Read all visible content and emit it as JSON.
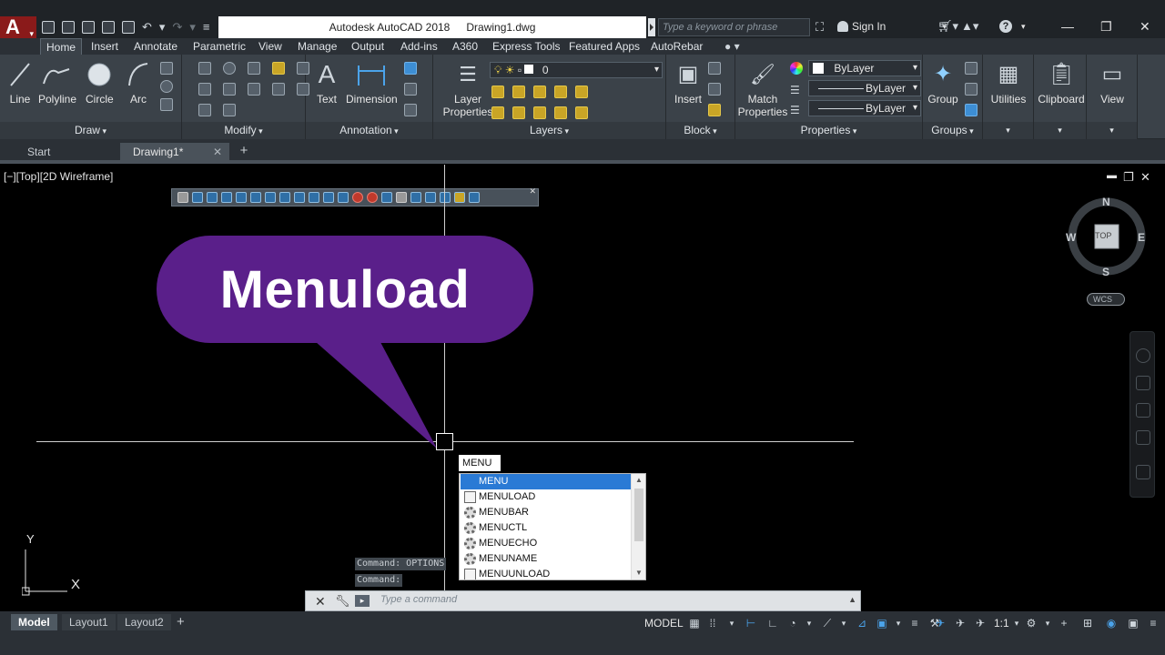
{
  "app": {
    "logo": "A",
    "title_app": "Autodesk AutoCAD 2018",
    "title_doc": "Drawing1.dwg",
    "search_placeholder": "Type a keyword or phrase",
    "sign_in": "Sign In"
  },
  "ribbon_tabs": [
    {
      "label": "Home",
      "active": true
    },
    {
      "label": "Insert"
    },
    {
      "label": "Annotate"
    },
    {
      "label": "Parametric"
    },
    {
      "label": "View"
    },
    {
      "label": "Manage"
    },
    {
      "label": "Output"
    },
    {
      "label": "Add-ins"
    },
    {
      "label": "A360"
    },
    {
      "label": "Express Tools"
    },
    {
      "label": "Featured Apps"
    },
    {
      "label": "AutoRebar"
    }
  ],
  "ribbon": {
    "draw": {
      "title": "Draw",
      "line": "Line",
      "polyline": "Polyline",
      "circle": "Circle",
      "arc": "Arc"
    },
    "modify": {
      "title": "Modify"
    },
    "annotation": {
      "title": "Annotation",
      "text": "Text",
      "dimension": "Dimension"
    },
    "layers": {
      "title": "Layers",
      "layer_properties_1": "Layer",
      "layer_properties_2": "Properties",
      "current_layer": "0"
    },
    "block": {
      "title": "Block",
      "insert": "Insert"
    },
    "properties": {
      "title": "Properties",
      "match_1": "Match",
      "match_2": "Properties",
      "color": "ByLayer",
      "linetype": "ByLayer",
      "lineweight": "ByLayer"
    },
    "groups": {
      "title": "Groups",
      "group": "Group"
    },
    "utilities": "Utilities",
    "clipboard": "Clipboard",
    "view": "View"
  },
  "file_tabs": [
    {
      "label": "Start"
    },
    {
      "label": "Drawing1*",
      "active": true
    }
  ],
  "viewport": {
    "label": "[−][Top][2D Wireframe]",
    "bubble_text": "Menuload",
    "compass": {
      "n": "N",
      "s": "S",
      "e": "E",
      "w": "W",
      "face": "TOP"
    },
    "wcs": "WCS",
    "ucs_x": "X",
    "ucs_y": "Y"
  },
  "autocomplete": {
    "typed": "MENU",
    "items": [
      {
        "label": "MENU",
        "icon": "none",
        "selected": true
      },
      {
        "label": "MENULOAD",
        "icon": "doc-icon"
      },
      {
        "label": "MENUBAR",
        "icon": "gear-icon"
      },
      {
        "label": "MENUCTL",
        "icon": "gear-icon"
      },
      {
        "label": "MENUECHO",
        "icon": "gear-icon"
      },
      {
        "label": "MENUNAME",
        "icon": "gear-icon"
      },
      {
        "label": "MENUUNLOAD",
        "icon": "doc-icon"
      }
    ]
  },
  "command": {
    "history_1": "Command: OPTIONS",
    "history_2": "Command:",
    "placeholder": "Type a command"
  },
  "layout_tabs": [
    {
      "label": "Model",
      "active": true
    },
    {
      "label": "Layout1"
    },
    {
      "label": "Layout2"
    }
  ],
  "status": {
    "model": "MODEL",
    "scale": "1:1"
  },
  "colors": {
    "bubble": "#5a1f8a",
    "selection": "#2a7ad5",
    "ribbon_bg": "#3b4249",
    "titlebar_bg": "#1f2327"
  }
}
